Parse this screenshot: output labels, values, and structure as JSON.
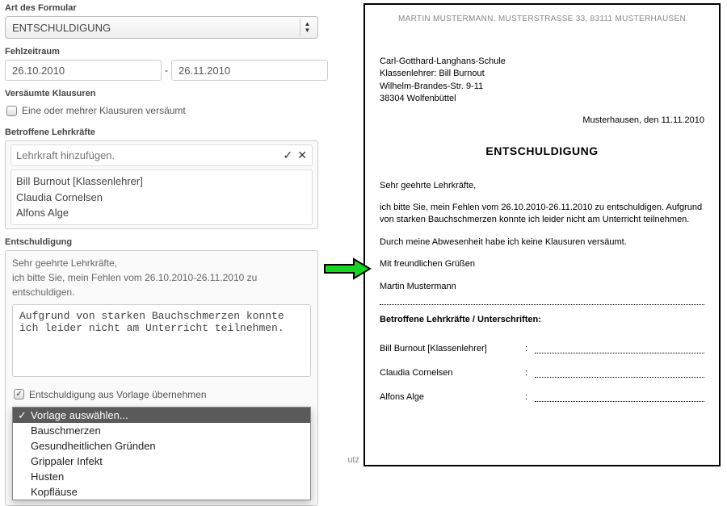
{
  "form": {
    "type_label": "Art des Formular",
    "type_value": "ENTSCHULDIGUNG",
    "period_label": "Fehlzeitraum",
    "date_from": "26.10.2010",
    "date_to": "26.11.2010",
    "date_sep": "-",
    "missed_exams_label": "Versäumte Klausuren",
    "missed_exams_checkbox": "Eine oder mehrer Klausuren versäumt",
    "teachers_label": "Betroffene Lehrkräfte",
    "add_teacher_placeholder": "Lehrkraft hinzufügen.",
    "teachers": [
      "Bill Burnout [Klassenlehrer]",
      "Claudia Cornelsen",
      "Alfons Alge"
    ],
    "excuse_label": "Entschuldigung",
    "excuse_prefix_line1": "Sehr geehrte Lehrkräfte,",
    "excuse_prefix_line2": "ich bitte Sie, mein Fehlen vom 26.10.2010-26.11.2010 zu entschuldigen.",
    "excuse_text": "Aufgrund von starken Bauchschmerzen konnte ich leider nicht am Unterricht teilnehmen.",
    "use_template_label": "Entschuldigung aus Vorlage übernehmen",
    "template_options": [
      "Vorlage auswählen...",
      "Bauschmerzen",
      "Gesundheitlichen Gründen",
      "Grippaler Infekt",
      "Husten",
      "Kopfläuse"
    ]
  },
  "document": {
    "sender_line": "MARTIN MUSTERMANN, MUSTERSTRASSE 33, 83111 MUSTERHAUSEN",
    "recipient": [
      "Carl-Gotthard-Langhans-Schule",
      "Klassenlehrer: Bill Burnout",
      "Wilhelm-Brandes-Str. 9-11",
      "38304 Wolfenbüttel"
    ],
    "date_line": "Musterhausen, den 11.11.2010",
    "title": "ENTSCHULDIGUNG",
    "salutation": "Sehr geehrte Lehrkräfte,",
    "body1": "ich bitte Sie, mein Fehlen vom 26.10.2010-26.11.2010 zu entschuldigen. Aufgrund von starken Bauchschmerzen konnte ich leider nicht am Unterricht teilnehmen.",
    "body2": "Durch meine Abwesenheit habe ich keine Klausuren versäumt.",
    "closing": "Mit freundlichen Grüßen",
    "sender_name": "Martin Mustermann",
    "sig_header": "Betroffene Lehrkräfte / Unterschriften:",
    "signatures": [
      "Bill Burnout [Klassenlehrer]",
      "Claudia Cornelsen",
      "Alfons Alge"
    ]
  },
  "misc": {
    "footer_fragment": "utz"
  }
}
